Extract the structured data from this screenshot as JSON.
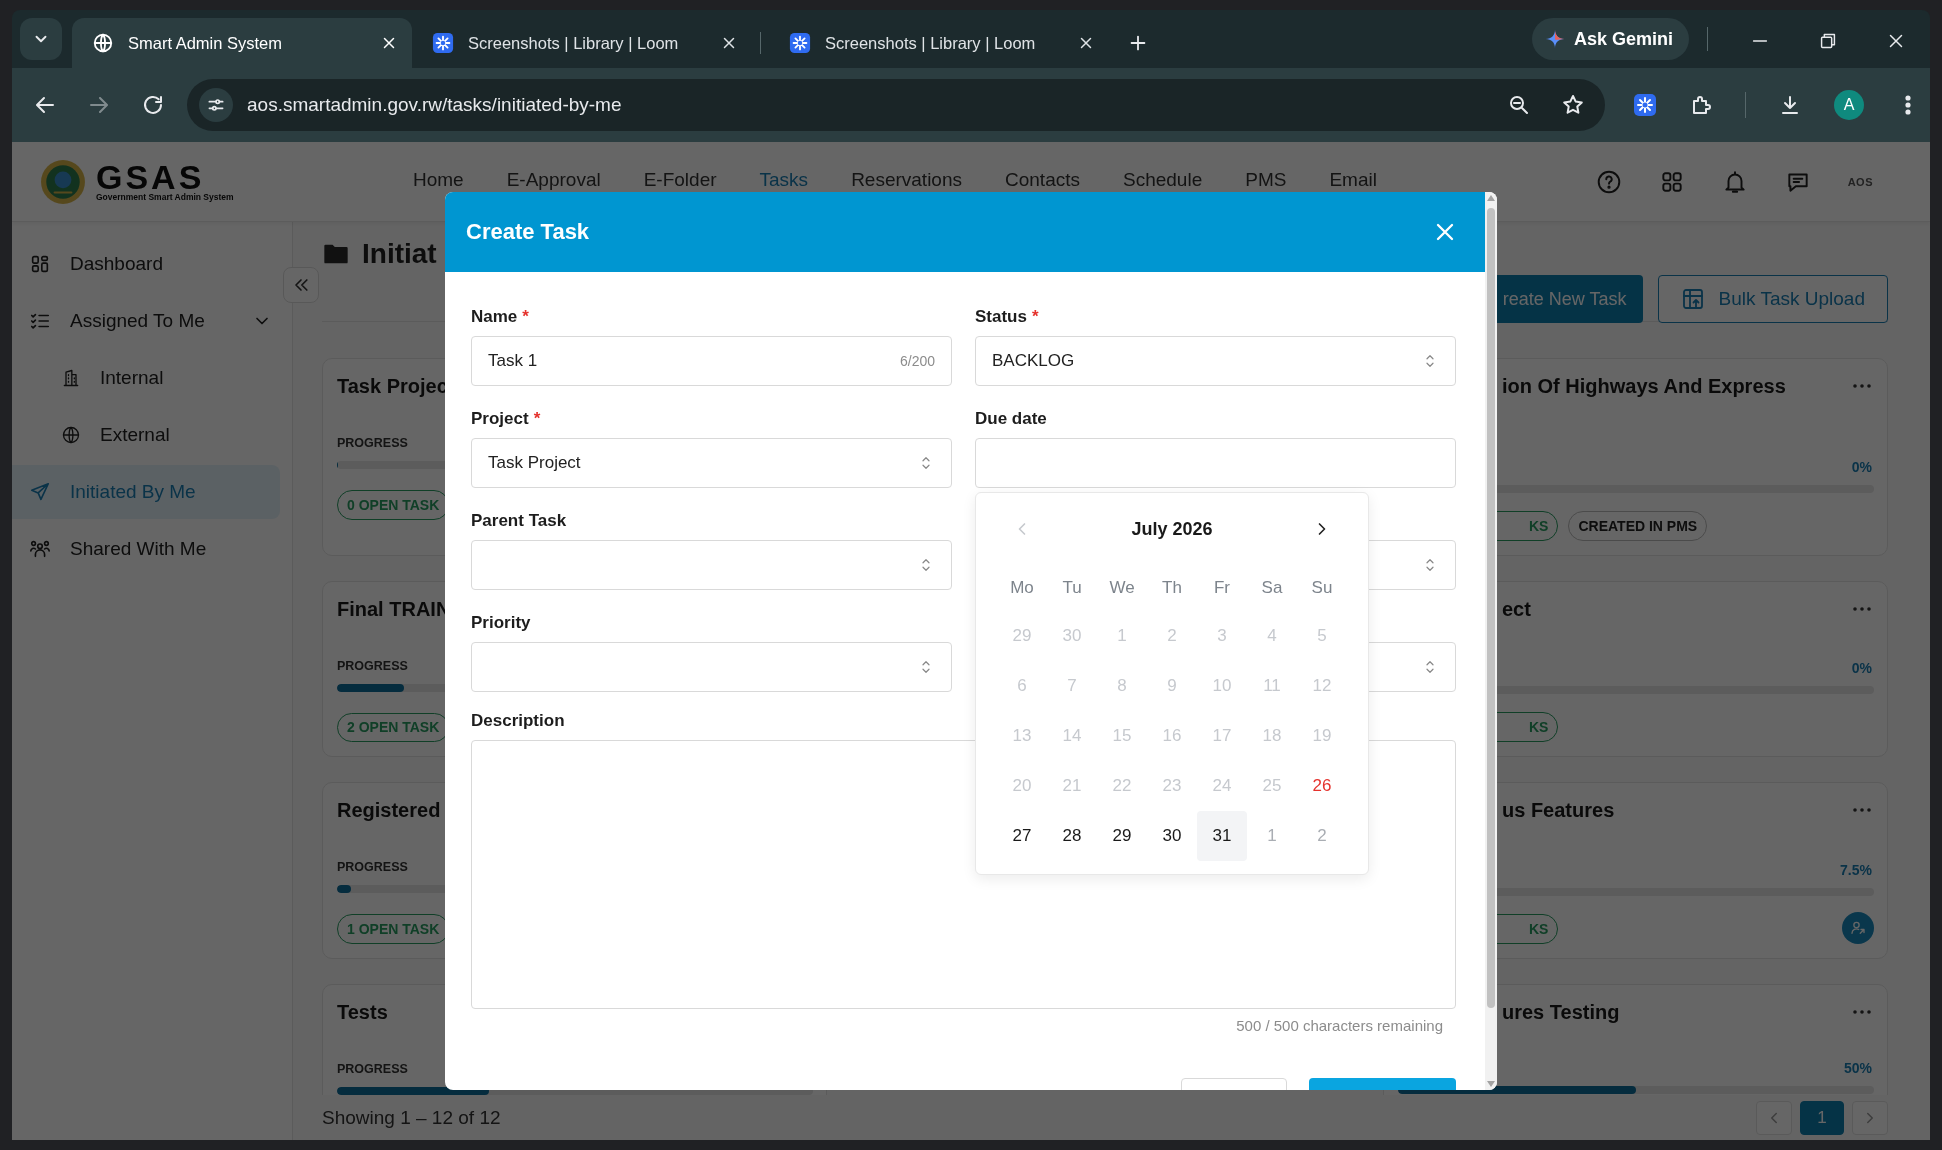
{
  "browser": {
    "tabs": [
      {
        "title": "Smart Admin System",
        "selected": true
      },
      {
        "title": "Screenshots | Library | Loom",
        "selected": false
      },
      {
        "title": "Screenshots | Library | Loom",
        "selected": false
      }
    ],
    "assistant_button": "Ask Gemini",
    "address": "aos.smartadmin.gov.rw/tasks/initiated-by-me",
    "profile_initial": "A"
  },
  "header": {
    "logo": "GSAS",
    "logo_caption": "Government Smart Admin System",
    "nav": [
      {
        "label": "Home",
        "selected": false
      },
      {
        "label": "E-Approval",
        "selected": false
      },
      {
        "label": "E-Folder",
        "selected": false
      },
      {
        "label": "Tasks",
        "selected": true
      },
      {
        "label": "Reservations",
        "selected": false
      },
      {
        "label": "Contacts",
        "selected": false
      },
      {
        "label": "Schedule",
        "selected": false
      },
      {
        "label": "PMS",
        "selected": false
      },
      {
        "label": "Email",
        "selected": false
      }
    ],
    "account_logo": "AOS"
  },
  "sidebar": {
    "items": [
      {
        "label": "Dashboard",
        "selected": false
      },
      {
        "label": "Assigned To Me",
        "selected": false,
        "expanded": true,
        "children": [
          {
            "label": "Internal",
            "selected": false
          },
          {
            "label": "External",
            "selected": false
          }
        ]
      },
      {
        "label": "Initiated By Me",
        "selected": true
      },
      {
        "label": "Shared With Me",
        "selected": false
      }
    ]
  },
  "board": {
    "title": "Initiat",
    "create_button": "reate New Task",
    "upload_button": "Bulk Task Upload",
    "left_cards": [
      {
        "title": "Task Projec",
        "progress_label": "PROGRESS",
        "level": 0,
        "tag": "0 OPEN TASK"
      },
      {
        "title": "Final TRAIN",
        "progress_label": "PROGRESS",
        "level": 0.14,
        "tag": "2 OPEN TASK"
      },
      {
        "title": "Registered",
        "progress_label": "PROGRESS",
        "level": 0.03,
        "tag": "1 OPEN TASK"
      },
      {
        "title": "Tests",
        "progress_label": "PROGRESS",
        "level": 0.32
      }
    ],
    "right_cards": [
      {
        "title": "ion Of Highways And Express",
        "percent": "0%",
        "level": 0,
        "tags": [
          {
            "label": "KS",
            "kind": "count"
          },
          {
            "label": "CREATED IN PMS",
            "kind": "source"
          }
        ],
        "assignee": false
      },
      {
        "title": "ect",
        "percent": "0%",
        "level": 0,
        "tags": [
          {
            "label": "KS",
            "kind": "count"
          }
        ],
        "assignee": false
      },
      {
        "title": "us Features",
        "percent": "7.5%",
        "level": 0.075,
        "tags": [
          {
            "label": "KS",
            "kind": "count"
          }
        ],
        "assignee": true
      },
      {
        "title": "ures Testing",
        "percent": "50%",
        "level": 0.5,
        "assignee": false
      }
    ],
    "summary": "Showing 1 – 12 of 12",
    "pages": [
      {
        "label": "1",
        "selected": true
      }
    ]
  },
  "modal": {
    "title": "Create Task",
    "fields": [
      {
        "label": "Name",
        "required_mark": "*",
        "kind": "text",
        "value": "Task 1",
        "counter": "6/200"
      },
      {
        "label": "Status",
        "required_mark": "*",
        "kind": "select",
        "value": "BACKLOG"
      },
      {
        "label": "Project",
        "required_mark": "*",
        "kind": "select",
        "value": "Task Project"
      },
      {
        "label": "Due date",
        "kind": "date"
      },
      {
        "label": "Parent Task",
        "kind": "select"
      },
      {
        "kind": "select"
      },
      {
        "label": "Priority",
        "kind": "select"
      },
      {
        "kind": "select"
      }
    ],
    "description": {
      "label": "Description",
      "remaining": "500 / 500 characters remaining"
    },
    "calendar": {
      "month": "July 2026",
      "prev_disabled": true,
      "weekdays": [
        "Mo",
        "Tu",
        "We",
        "Th",
        "Fr",
        "Sa",
        "Su"
      ],
      "days": [
        {
          "label": "29",
          "kind": "disabled",
          "selected": false
        },
        {
          "label": "30",
          "kind": "disabled",
          "selected": false
        },
        {
          "label": "1",
          "kind": "disabled",
          "selected": false
        },
        {
          "label": "2",
          "kind": "disabled",
          "selected": false
        },
        {
          "label": "3",
          "kind": "disabled",
          "selected": false
        },
        {
          "label": "4",
          "kind": "disabled",
          "selected": false
        },
        {
          "label": "5",
          "kind": "disabled",
          "selected": false
        },
        {
          "label": "6",
          "kind": "disabled",
          "selected": false
        },
        {
          "label": "7",
          "kind": "disabled",
          "selected": false
        },
        {
          "label": "8",
          "kind": "disabled",
          "selected": false
        },
        {
          "label": "9",
          "kind": "disabled",
          "selected": false
        },
        {
          "label": "10",
          "kind": "disabled",
          "selected": false
        },
        {
          "label": "11",
          "kind": "disabled",
          "selected": false
        },
        {
          "label": "12",
          "kind": "disabled",
          "selected": false
        },
        {
          "label": "13",
          "kind": "disabled",
          "selected": false
        },
        {
          "label": "14",
          "kind": "disabled",
          "selected": false
        },
        {
          "label": "15",
          "kind": "disabled",
          "selected": false
        },
        {
          "label": "16",
          "kind": "disabled",
          "selected": false
        },
        {
          "label": "17",
          "kind": "disabled",
          "selected": false
        },
        {
          "label": "18",
          "kind": "disabled",
          "selected": false
        },
        {
          "label": "19",
          "kind": "disabled",
          "selected": false
        },
        {
          "label": "20",
          "kind": "disabled",
          "selected": false
        },
        {
          "label": "21",
          "kind": "disabled",
          "selected": false
        },
        {
          "label": "22",
          "kind": "disabled",
          "selected": false
        },
        {
          "label": "23",
          "kind": "disabled",
          "selected": false
        },
        {
          "label": "24",
          "kind": "disabled",
          "selected": false
        },
        {
          "label": "25",
          "kind": "disabled",
          "selected": false
        },
        {
          "label": "26",
          "kind": "today",
          "selected": false
        },
        {
          "label": "27",
          "kind": "available",
          "selected": false
        },
        {
          "label": "28",
          "kind": "available",
          "selected": false
        },
        {
          "label": "29",
          "kind": "available",
          "selected": false
        },
        {
          "label": "30",
          "kind": "available",
          "selected": false
        },
        {
          "label": "31",
          "kind": "available",
          "selected": true
        },
        {
          "label": "1",
          "kind": "outside",
          "selected": false
        },
        {
          "label": "2",
          "kind": "outside",
          "selected": false
        }
      ]
    }
  }
}
